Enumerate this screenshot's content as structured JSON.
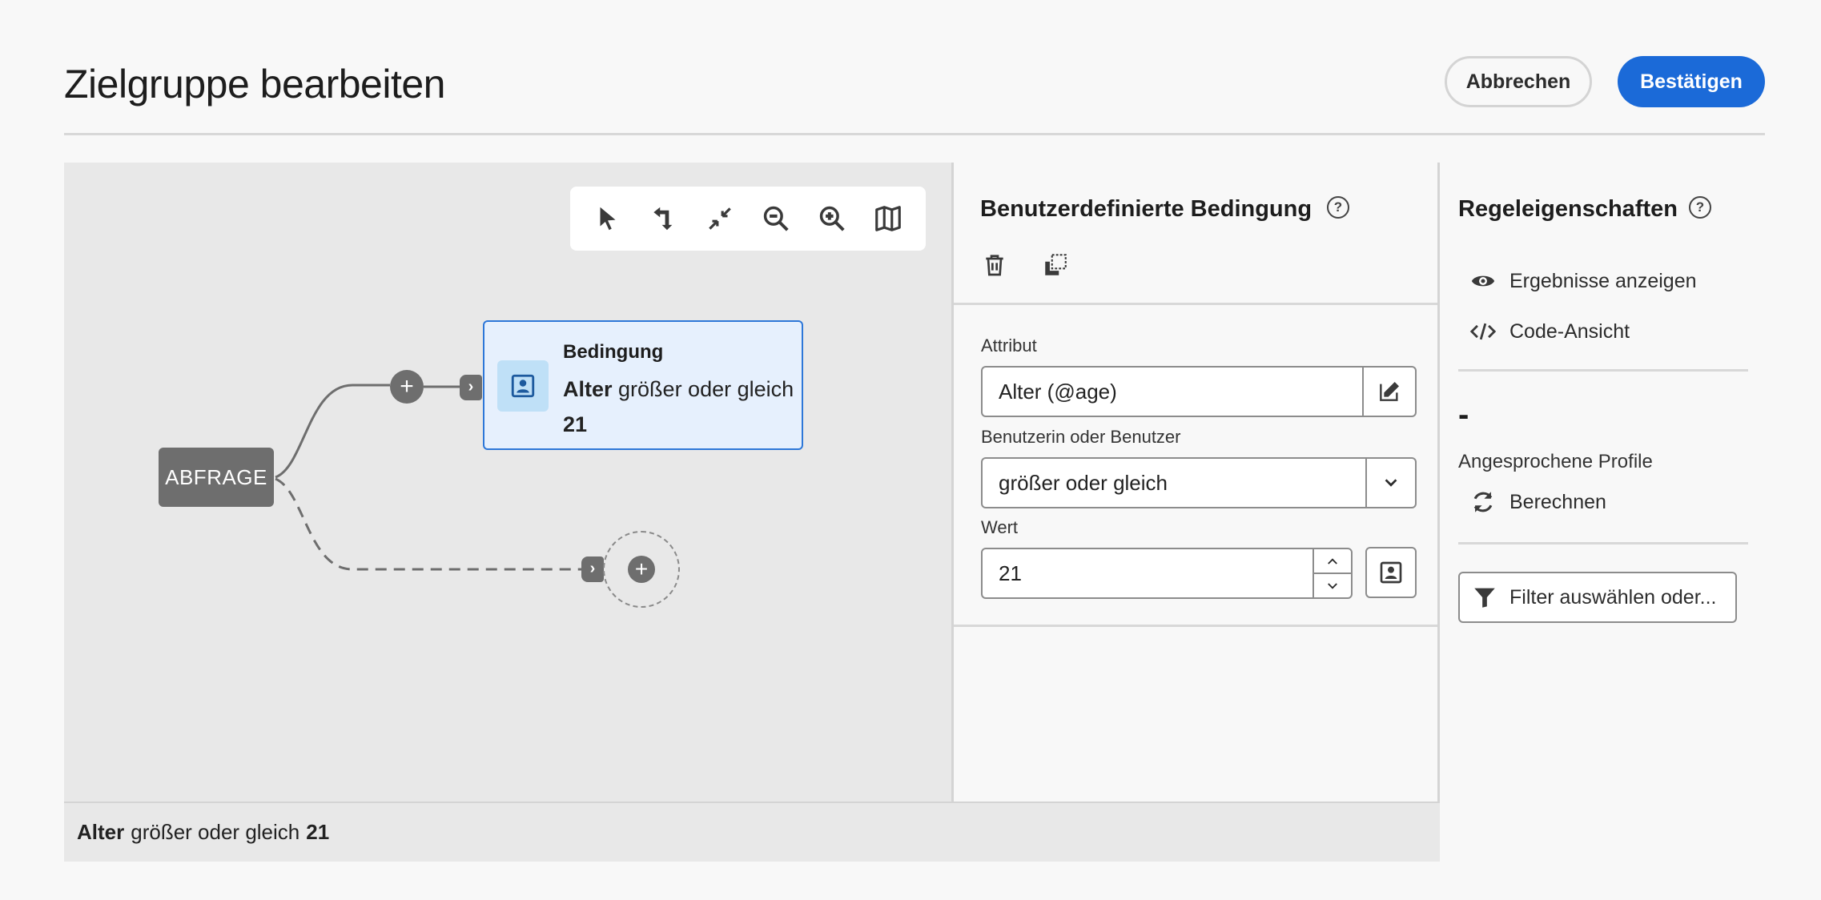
{
  "header": {
    "title": "Zielgruppe bearbeiten",
    "cancel_label": "Abbrechen",
    "confirm_label": "Bestätigen"
  },
  "canvas": {
    "toolbar": [
      "select-tool-icon",
      "move-tool-icon",
      "collapse-icon",
      "zoom-out-icon",
      "zoom-in-icon",
      "map-icon"
    ],
    "query_node_label": "ABFRAGE",
    "condition_card": {
      "title": "Bedingung",
      "attribute": "Alter",
      "operator_text": "größer oder gleich",
      "value": "21"
    },
    "footer": {
      "attribute": "Alter",
      "operator_text": "größer oder gleich",
      "value": "21"
    }
  },
  "condition_panel": {
    "title": "Benutzerdefinierte Bedingung",
    "help": "?",
    "attribute_label": "Attribut",
    "attribute_value": "Alter (@age)",
    "operator_label": "Benutzerin oder Benutzer",
    "operator_value": "größer oder gleich",
    "value_label": "Wert",
    "value_value": "21"
  },
  "rule_properties": {
    "title": "Regeleigenschaften",
    "help": "?",
    "show_results": "Ergebnisse anzeigen",
    "code_view": "Code-Ansicht",
    "count_value": "-",
    "targeted_profiles_label": "Angesprochene Profile",
    "calculate": "Berechnen",
    "filter_button": "Filter auswählen oder..."
  },
  "colors": {
    "accent": "#1b6ad8",
    "card_bg": "#e6f0fd",
    "node_gray": "#6e6e6e"
  }
}
